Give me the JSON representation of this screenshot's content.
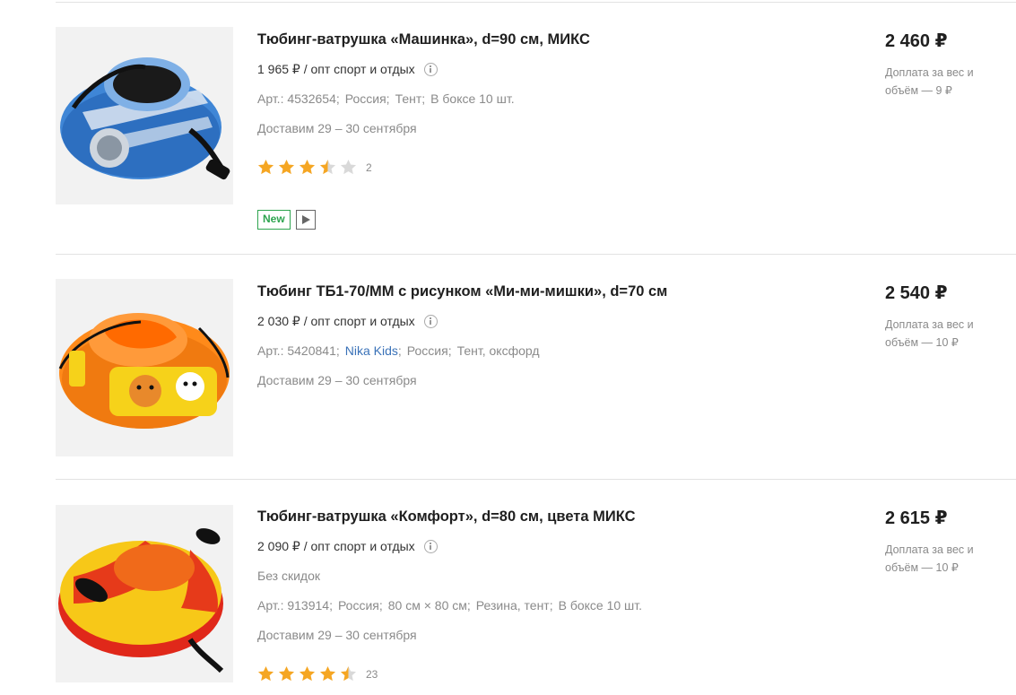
{
  "products": [
    {
      "title": "Тюбинг-ватрушка «Машинка», d=90 см, МИКС",
      "opt_price": "1 965 ₽ / опт спорт и отдых",
      "attributes": [
        "Арт.: 4532654;",
        "Россия;",
        "Тент;",
        "В боксе 10 шт."
      ],
      "delivery": "Доставим 29 – 30 сентября",
      "rating": 3.5,
      "reviews": "2",
      "badge_new": "New",
      "price": "2 460 ₽",
      "surcharge": "Доплата за вес и объём — 9 ₽",
      "image_icon": "blue-car-tubing-image"
    },
    {
      "title": "Тюбинг ТБ1-70/ММ с рисунком «Ми-ми-мишки», d=70 см",
      "opt_price": "2 030 ₽ / опт спорт и отдых",
      "art": "Арт.: 5420841;",
      "brand": "Nika Kids",
      "attributes": [
        "Россия;",
        "Тент, оксфорд"
      ],
      "delivery": "Доставим 29 – 30 сентября",
      "price": "2 540 ₽",
      "surcharge": "Доплата за вес и объём — 10 ₽",
      "image_icon": "orange-mimimishki-tubing-image"
    },
    {
      "title": "Тюбинг-ватрушка «Комфорт», d=80 см, цвета МИКС",
      "opt_price": "2 090 ₽ / опт спорт и отдых",
      "no_discount": "Без скидок",
      "attributes": [
        "Арт.: 913914;",
        "Россия;",
        "80 см × 80 см;",
        "Резина, тент;",
        "В боксе 10 шт."
      ],
      "delivery": "Доставим 29 – 30 сентября",
      "rating": 4.5,
      "reviews": "23",
      "price": "2 615 ₽",
      "surcharge": "Доплата за вес и объём — 10 ₽",
      "image_icon": "red-yellow-tubing-image"
    }
  ],
  "colors": {
    "star_filled": "#f5a623",
    "star_empty": "#d9d9d9",
    "new_badge": "#2ea44f",
    "brand_link": "#3a72b8"
  }
}
